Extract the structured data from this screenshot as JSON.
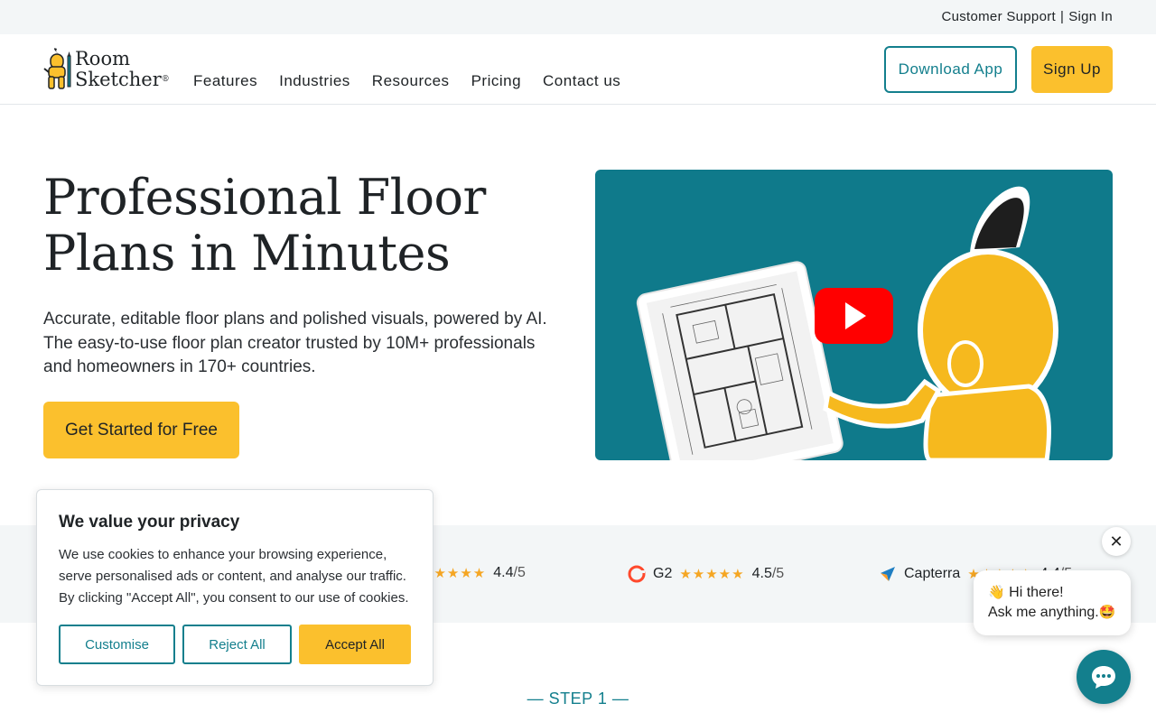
{
  "topbar": {
    "support": "Customer Support",
    "separator": "|",
    "signin": "Sign In"
  },
  "brand": {
    "line1": "Room",
    "line2": "Sketcher",
    "mark": "®"
  },
  "nav": {
    "features": "Features",
    "industries": "Industries",
    "resources": "Resources",
    "pricing": "Pricing",
    "contact": "Contact us"
  },
  "header_buttons": {
    "download": "Download App",
    "signup": "Sign Up"
  },
  "hero": {
    "title_line1": "Professional Floor",
    "title_line2": "Plans in Minutes",
    "subtitle": "Accurate, editable floor plans and polished visuals, powered by AI. The easy-to-use floor plan creator trusted by 10M+ professionals and homeowners in 170+ countries.",
    "cta": "Get Started for Free"
  },
  "ratings": [
    {
      "name": "",
      "score": "4.4",
      "denom": "/5"
    },
    {
      "name": "G2",
      "score": "4.5",
      "denom": "/5"
    },
    {
      "name": "Capterra",
      "score": "4.4",
      "denom": "/5"
    }
  ],
  "step": "— STEP 1 —",
  "cookie": {
    "title": "We value your privacy",
    "body": "We use cookies to enhance your browsing experience, serve personalised ads or content, and analyse our traffic. By clicking \"Accept All\", you consent to our use of cookies.",
    "customise": "Customise",
    "reject": "Reject All",
    "accept": "Accept All"
  },
  "chat": {
    "greeting": "Hi there!",
    "prompt": "Ask me anything.",
    "close": "✕"
  },
  "colors": {
    "teal": "#137f8d",
    "yellow": "#fbc02d",
    "video_bg": "#0f7a8b",
    "youtube_red": "#ff0000"
  },
  "icons": [
    "roomsketcher-logo-icon",
    "youtube-play-icon",
    "g2-logo-icon",
    "capterra-logo-icon",
    "star-icon",
    "close-icon",
    "chat-icon"
  ]
}
